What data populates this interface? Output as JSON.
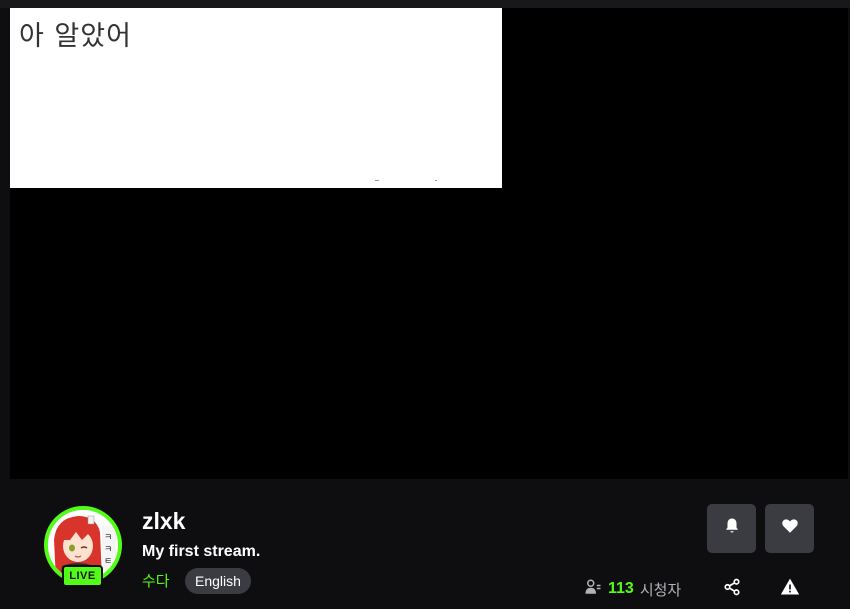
{
  "video": {
    "overlay_text": "아 알았어"
  },
  "channel": {
    "name": "zlxk",
    "live_label": "LIVE",
    "stream_title": "My first stream.",
    "category": "수다",
    "language": "English"
  },
  "actions": {
    "notify_icon": "bell-icon",
    "follow_icon": "heart-icon",
    "share_icon": "share-icon",
    "report_icon": "warning-icon"
  },
  "viewers": {
    "count": "113",
    "label": "시청자"
  },
  "colors": {
    "accent": "#53fc18",
    "background": "#0e0e10",
    "button": "#3a3c42"
  }
}
